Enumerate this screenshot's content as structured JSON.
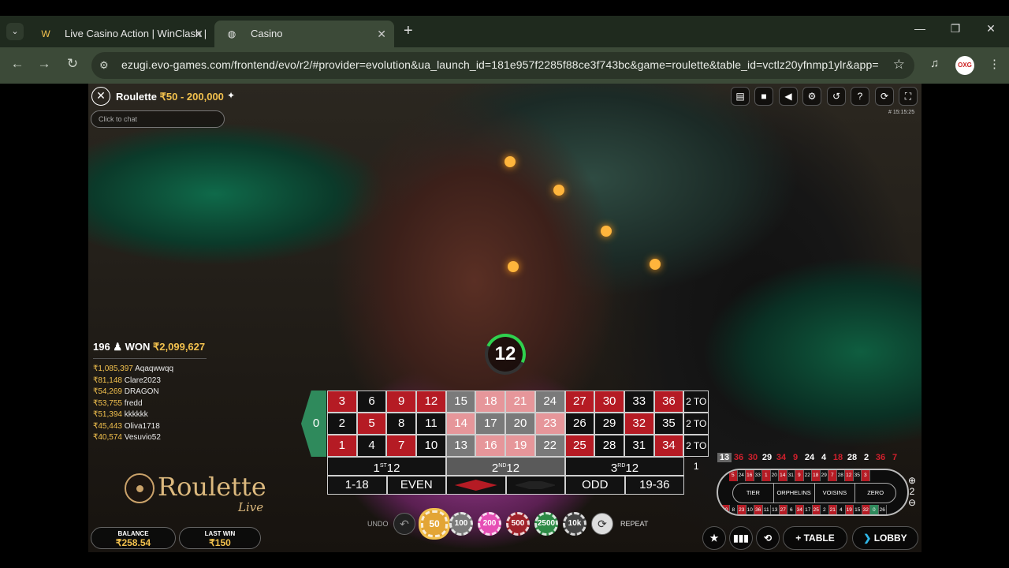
{
  "browser": {
    "tabs": [
      {
        "title": "Live Casino Action | WinClash |"
      },
      {
        "title": "Casino"
      }
    ],
    "url": "ezugi.evo-games.com/frontend/evo/r2/#provider=evolution&ua_launch_id=181e957f2285f88ce3f743bc&game=roulette&table_id=vctlz20yfnmp1ylr&app=",
    "profile_initials": "OXG"
  },
  "game": {
    "title": "Roulette",
    "limits": "₹50 - 200,000",
    "chat_placeholder": "Click to chat",
    "clock": "# 15:15:25",
    "timer": "12",
    "players": "196",
    "won_label": "WON",
    "won_amount": "₹2,099,627",
    "winners": [
      {
        "amount": "₹1,085,397",
        "name": "Aqaqwwqq"
      },
      {
        "amount": "₹81,148",
        "name": "Clare2023"
      },
      {
        "amount": "₹54,269",
        "name": "DRAGON"
      },
      {
        "amount": "₹53,755",
        "name": "fredd"
      },
      {
        "amount": "₹51,394",
        "name": "kkkkkk"
      },
      {
        "amount": "₹45,443",
        "name": "Oliva1718"
      },
      {
        "amount": "₹40,574",
        "name": "Vesuvio52"
      }
    ],
    "logo_title": "Roulette",
    "logo_sub": "Live",
    "balance_label": "BALANCE",
    "balance": "₹258.54",
    "last_win_label": "LAST WIN",
    "last_win": "₹150"
  },
  "board": {
    "zero": "0",
    "rows": [
      [
        {
          "n": "3",
          "c": "r"
        },
        {
          "n": "6",
          "c": "b"
        },
        {
          "n": "9",
          "c": "r"
        },
        {
          "n": "12",
          "c": "r"
        },
        {
          "n": "15",
          "c": "hb"
        },
        {
          "n": "18",
          "c": "hr"
        },
        {
          "n": "21",
          "c": "hr"
        },
        {
          "n": "24",
          "c": "hb"
        },
        {
          "n": "27",
          "c": "r"
        },
        {
          "n": "30",
          "c": "r"
        },
        {
          "n": "33",
          "c": "b"
        },
        {
          "n": "36",
          "c": "r"
        }
      ],
      [
        {
          "n": "2",
          "c": "b"
        },
        {
          "n": "5",
          "c": "r"
        },
        {
          "n": "8",
          "c": "b"
        },
        {
          "n": "11",
          "c": "b"
        },
        {
          "n": "14",
          "c": "hr"
        },
        {
          "n": "17",
          "c": "hb"
        },
        {
          "n": "20",
          "c": "hb"
        },
        {
          "n": "23",
          "c": "hr"
        },
        {
          "n": "26",
          "c": "b"
        },
        {
          "n": "29",
          "c": "b"
        },
        {
          "n": "32",
          "c": "r"
        },
        {
          "n": "35",
          "c": "b"
        }
      ],
      [
        {
          "n": "1",
          "c": "r"
        },
        {
          "n": "4",
          "c": "b"
        },
        {
          "n": "7",
          "c": "r"
        },
        {
          "n": "10",
          "c": "b"
        },
        {
          "n": "13",
          "c": "hb"
        },
        {
          "n": "16",
          "c": "hr"
        },
        {
          "n": "19",
          "c": "hr"
        },
        {
          "n": "22",
          "c": "hb"
        },
        {
          "n": "25",
          "c": "r"
        },
        {
          "n": "28",
          "c": "b"
        },
        {
          "n": "31",
          "c": "b"
        },
        {
          "n": "34",
          "c": "r"
        }
      ]
    ],
    "column_bet": "2 TO 1",
    "dozens": [
      {
        "n": "1",
        "sup": "ST",
        "tail": "12"
      },
      {
        "n": "2",
        "sup": "ND",
        "tail": "12"
      },
      {
        "n": "3",
        "sup": "RD",
        "tail": "12"
      }
    ],
    "evens": [
      "1-18",
      "EVEN",
      "",
      "",
      "ODD",
      "19-36"
    ],
    "colors": {
      "red": "#b51b24",
      "black": "#111111"
    }
  },
  "chips": {
    "undo": "UNDO",
    "repeat": "REPEAT",
    "values": [
      {
        "label": "50",
        "color": "#e3a535",
        "selected": true
      },
      {
        "label": "100",
        "color": "#7a7a7a"
      },
      {
        "label": "200",
        "color": "#e64fb5"
      },
      {
        "label": "500",
        "color": "#a0222a"
      },
      {
        "label": "2500",
        "color": "#2d8a46"
      },
      {
        "label": "10k",
        "color": "#444"
      }
    ]
  },
  "history": [
    {
      "n": "13",
      "c": "g"
    },
    {
      "n": "36",
      "c": "r"
    },
    {
      "n": "30",
      "c": "r"
    },
    {
      "n": "29",
      "c": "w"
    },
    {
      "n": "34",
      "c": "r"
    },
    {
      "n": "9",
      "c": "r"
    },
    {
      "n": "24",
      "c": "w"
    },
    {
      "n": "4",
      "c": "w"
    },
    {
      "n": "18",
      "c": "r"
    },
    {
      "n": "28",
      "c": "w"
    },
    {
      "n": "2",
      "c": "w"
    },
    {
      "n": "36",
      "c": "r"
    },
    {
      "n": "7",
      "c": "r"
    }
  ],
  "racetrack": {
    "top": [
      {
        "n": "5",
        "c": "r"
      },
      {
        "n": "24",
        "c": "b"
      },
      {
        "n": "16",
        "c": "r"
      },
      {
        "n": "33",
        "c": "b"
      },
      {
        "n": "1",
        "c": "r"
      },
      {
        "n": "20",
        "c": "b"
      },
      {
        "n": "14",
        "c": "r"
      },
      {
        "n": "31",
        "c": "b"
      },
      {
        "n": "9",
        "c": "r"
      },
      {
        "n": "22",
        "c": "b"
      },
      {
        "n": "18",
        "c": "r"
      },
      {
        "n": "29",
        "c": "b"
      },
      {
        "n": "7",
        "c": "r"
      },
      {
        "n": "28",
        "c": "b"
      },
      {
        "n": "12",
        "c": "r"
      },
      {
        "n": "35",
        "c": "b"
      },
      {
        "n": "3",
        "c": "r"
      }
    ],
    "bottom": [
      {
        "n": "30",
        "c": "r"
      },
      {
        "n": "8",
        "c": "b"
      },
      {
        "n": "23",
        "c": "r"
      },
      {
        "n": "10",
        "c": "b"
      },
      {
        "n": "36",
        "c": "r"
      },
      {
        "n": "11",
        "c": "b"
      },
      {
        "n": "13",
        "c": "b"
      },
      {
        "n": "27",
        "c": "r"
      },
      {
        "n": "6",
        "c": "b"
      },
      {
        "n": "34",
        "c": "r"
      },
      {
        "n": "17",
        "c": "b"
      },
      {
        "n": "25",
        "c": "r"
      },
      {
        "n": "2",
        "c": "b"
      },
      {
        "n": "21",
        "c": "r"
      },
      {
        "n": "4",
        "c": "b"
      },
      {
        "n": "19",
        "c": "r"
      },
      {
        "n": "15",
        "c": "b"
      },
      {
        "n": "32",
        "c": "r"
      },
      {
        "n": "0",
        "c": "g"
      },
      {
        "n": "26",
        "c": "b"
      }
    ],
    "sections": [
      "TIER",
      "ORPHELINS",
      "VOISINS",
      "ZERO"
    ],
    "zoom": "2"
  },
  "bottom": {
    "table": "TABLE",
    "lobby": "LOBBY"
  }
}
